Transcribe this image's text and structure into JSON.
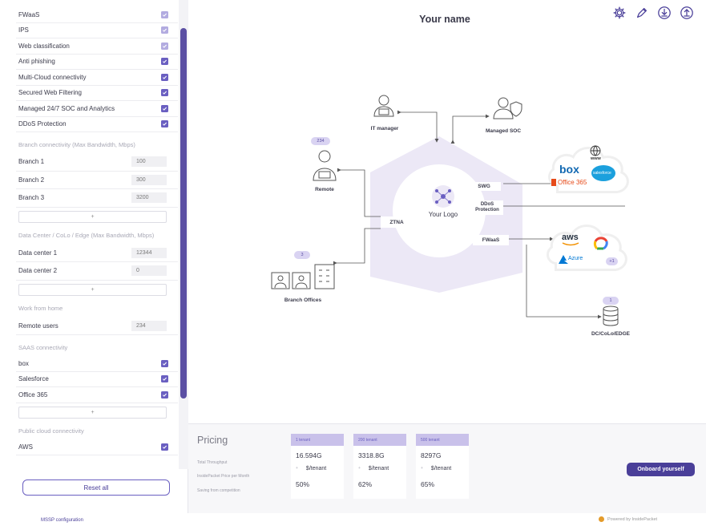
{
  "header": {
    "title": "Your name",
    "icons": [
      "gear-icon",
      "edit-icon",
      "download-icon",
      "upload-icon"
    ]
  },
  "sidebar": {
    "services": [
      {
        "label": "FWaaS",
        "checked": true,
        "style": "light"
      },
      {
        "label": "IPS",
        "checked": true,
        "style": "light"
      },
      {
        "label": "Web classification",
        "checked": true,
        "style": "light"
      },
      {
        "label": "Anti phishing",
        "checked": true,
        "style": "on"
      },
      {
        "label": "Multi-Cloud connectivity",
        "checked": true,
        "style": "on"
      },
      {
        "label": "Secured Web Filtering",
        "checked": true,
        "style": "on"
      },
      {
        "label": "Managed 24/7 SOC and Analytics",
        "checked": true,
        "style": "on"
      },
      {
        "label": "DDoS Protection",
        "checked": true,
        "style": "on"
      }
    ],
    "branch_title": "Branch connectivity (Max Bandwidth, Mbps)",
    "branches": [
      {
        "label": "Branch 1",
        "value": "100"
      },
      {
        "label": "Branch 2",
        "value": "300"
      },
      {
        "label": "Branch 3",
        "value": "3200"
      }
    ],
    "dc_title": "Data Center / CoLo / Edge (Max Bandwidth, Mbps)",
    "datacenters": [
      {
        "label": "Data center 1",
        "value": "12344"
      },
      {
        "label": "Data center 2",
        "value": "0"
      }
    ],
    "wfh_title": "Work from home",
    "remote": {
      "label": "Remote users",
      "value": "234"
    },
    "saas_title": "SAAS connectivity",
    "saas": [
      {
        "label": "box",
        "checked": true
      },
      {
        "label": "Salesforce",
        "checked": true
      },
      {
        "label": "Office 365",
        "checked": true
      }
    ],
    "cloud_title": "Public cloud connectivity",
    "clouds": [
      {
        "label": "AWS",
        "checked": true
      }
    ],
    "add_label": "+",
    "reset_label": "Reset all"
  },
  "diagram": {
    "it_manager": "IT manager",
    "managed_soc": "Managed SOC",
    "remote": "Remote",
    "remote_count": "234",
    "branch_offices": "Branch Offices",
    "branch_count": "3",
    "ztna": "ZTNA",
    "logo": "Your Logo",
    "swg": "SWG",
    "ddos": "DDoS Protection",
    "fwaas": "FWaaS",
    "dc": "DC/CoLo/EDGE",
    "dc_count": "1",
    "saas_www": "www",
    "saas_box": "box",
    "saas_salesforce": "salesforce",
    "saas_office": "Office 365",
    "cloud_aws": "aws",
    "cloud_azure": "Azure",
    "cloud_more": "+1"
  },
  "pricing": {
    "title": "Pricing",
    "row_labels": [
      "Total Throughput",
      "InsidePacket Price per Month",
      "Saving from competition"
    ],
    "tiers": [
      {
        "head": "1 tenant",
        "throughput": "16.594G",
        "price": "$/tenant",
        "saving": "50%"
      },
      {
        "head": "200 tenant",
        "throughput": "3318.8G",
        "price": "$/tenant",
        "saving": "62%"
      },
      {
        "head": "500 tenant",
        "throughput": "8297G",
        "price": "$/tenant",
        "saving": "65%"
      }
    ],
    "onboard_label": "Onboard yourself"
  },
  "footer": {
    "left": "MSSP configuration",
    "right": "Powered by InsidePacket"
  },
  "colors": {
    "accent": "#6a5fc1",
    "dark_accent": "#4a3f99",
    "hex_fill": "#ece8f6"
  }
}
